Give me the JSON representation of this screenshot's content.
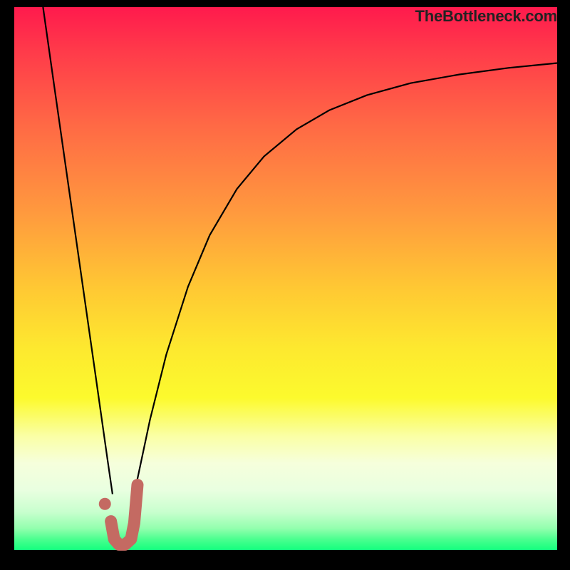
{
  "watermark": {
    "text": "TheBottleneck.com"
  },
  "chart_data": {
    "type": "line",
    "title": "",
    "xlabel": "",
    "ylabel": "",
    "xlim": [
      0,
      100
    ],
    "ylim": [
      0,
      100
    ],
    "series": [
      {
        "name": "left-branch",
        "x": [
          5.3,
          7.5,
          10.0,
          12.5,
          15.0,
          17.2,
          18.1
        ],
        "values": [
          100,
          84.5,
          67.0,
          49.5,
          32.0,
          16.5,
          10.3
        ]
      },
      {
        "name": "right-branch",
        "x": [
          22.5,
          25.0,
          28.0,
          32.0,
          36.0,
          41.0,
          46.0,
          52.0,
          58.0,
          65.0,
          73.0,
          82.0,
          91.0,
          100.0
        ],
        "values": [
          12.2,
          24.0,
          36.0,
          48.5,
          58.0,
          66.5,
          72.5,
          77.5,
          81.0,
          83.8,
          86.0,
          87.6,
          88.8,
          89.7
        ]
      },
      {
        "name": "highlight-j",
        "x": [
          17.8,
          18.4,
          19.3,
          20.4,
          21.5,
          22.1,
          22.4,
          22.7
        ],
        "values": [
          5.3,
          2.0,
          1.0,
          1.0,
          2.0,
          5.0,
          8.5,
          12.0
        ]
      },
      {
        "name": "highlight-dot",
        "x": [
          16.7
        ],
        "values": [
          8.5
        ]
      }
    ]
  },
  "colors": {
    "curve": "#000000",
    "highlight": "#c46a62"
  }
}
